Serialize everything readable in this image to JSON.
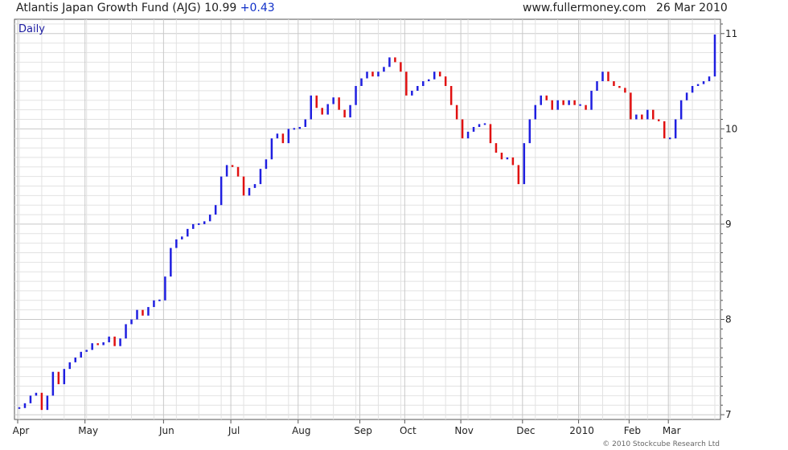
{
  "header": {
    "title": "Atlantis Japan Growth Fund (AJG) 10.99",
    "change": "+0.43",
    "site": "www.fullermoney.com",
    "date": "26 Mar 2010"
  },
  "period_label": "Daily",
  "copyright": "© 2010 Stockcube Research Ltd",
  "colors": {
    "up": "#1f1fe0",
    "down": "#e01010",
    "grid": "#e2e2e2",
    "major_grid": "#c8c8c8"
  },
  "chart_data": {
    "type": "line",
    "style": "close-to-close bars colored by direction (blue up, red down)",
    "x_ticks": [
      "Apr",
      "May",
      "Jun",
      "Jul",
      "Aug",
      "Sep",
      "Oct",
      "Nov",
      "Dec",
      "2010",
      "Feb",
      "Mar"
    ],
    "y_ticks": [
      7,
      8,
      9,
      10,
      11
    ],
    "ylim": [
      6.95,
      11.15
    ],
    "grid": true,
    "series": [
      {
        "points": [
          [
            "Apr",
            7.07
          ],
          [
            "Apr",
            7.12
          ],
          [
            "Apr",
            7.2
          ],
          [
            "Apr",
            7.23
          ],
          [
            "Apr",
            7.05
          ],
          [
            "Apr",
            7.2
          ],
          [
            "Apr",
            7.45
          ],
          [
            "Apr",
            7.32
          ],
          [
            "Apr",
            7.48
          ],
          [
            "Apr",
            7.55
          ],
          [
            "Apr",
            7.6
          ],
          [
            "Apr",
            7.66
          ],
          [
            "May",
            7.68
          ],
          [
            "May",
            7.75
          ],
          [
            "May",
            7.73
          ],
          [
            "May",
            7.76
          ],
          [
            "May",
            7.82
          ],
          [
            "May",
            7.72
          ],
          [
            "May",
            7.8
          ],
          [
            "May",
            7.95
          ],
          [
            "May",
            8.0
          ],
          [
            "May",
            8.1
          ],
          [
            "May",
            8.04
          ],
          [
            "May",
            8.13
          ],
          [
            "May",
            8.2
          ],
          [
            "May",
            8.2
          ],
          [
            "Jun",
            8.45
          ],
          [
            "Jun",
            8.75
          ],
          [
            "Jun",
            8.84
          ],
          [
            "Jun",
            8.87
          ],
          [
            "Jun",
            8.95
          ],
          [
            "Jun",
            9.0
          ],
          [
            "Jun",
            9.0
          ],
          [
            "Jun",
            9.03
          ],
          [
            "Jun",
            9.1
          ],
          [
            "Jun",
            9.2
          ],
          [
            "Jun",
            9.5
          ],
          [
            "Jun",
            9.62
          ],
          [
            "Jul",
            9.6
          ],
          [
            "Jul",
            9.5
          ],
          [
            "Jul",
            9.3
          ],
          [
            "Jul",
            9.38
          ],
          [
            "Jul",
            9.42
          ],
          [
            "Jul",
            9.58
          ],
          [
            "Jul",
            9.68
          ],
          [
            "Jul",
            9.9
          ],
          [
            "Jul",
            9.95
          ],
          [
            "Jul",
            9.85
          ],
          [
            "Jul",
            10.0
          ],
          [
            "Jul",
            10.0
          ],
          [
            "Aug",
            10.02
          ],
          [
            "Aug",
            10.1
          ],
          [
            "Aug",
            10.35
          ],
          [
            "Aug",
            10.22
          ],
          [
            "Aug",
            10.15
          ],
          [
            "Aug",
            10.26
          ],
          [
            "Aug",
            10.33
          ],
          [
            "Aug",
            10.2
          ],
          [
            "Aug",
            10.12
          ],
          [
            "Aug",
            10.25
          ],
          [
            "Aug",
            10.45
          ],
          [
            "Sep",
            10.53
          ],
          [
            "Sep",
            10.6
          ],
          [
            "Sep",
            10.55
          ],
          [
            "Sep",
            10.6
          ],
          [
            "Sep",
            10.65
          ],
          [
            "Sep",
            10.75
          ],
          [
            "Sep",
            10.7
          ],
          [
            "Sep",
            10.6
          ],
          [
            "Oct",
            10.35
          ],
          [
            "Oct",
            10.4
          ],
          [
            "Oct",
            10.45
          ],
          [
            "Oct",
            10.5
          ],
          [
            "Oct",
            10.52
          ],
          [
            "Oct",
            10.6
          ],
          [
            "Oct",
            10.55
          ],
          [
            "Oct",
            10.45
          ],
          [
            "Oct",
            10.25
          ],
          [
            "Oct",
            10.1
          ],
          [
            "Nov",
            9.9
          ],
          [
            "Nov",
            9.97
          ],
          [
            "Nov",
            10.02
          ],
          [
            "Nov",
            10.05
          ],
          [
            "Nov",
            10.05
          ],
          [
            "Nov",
            9.85
          ],
          [
            "Nov",
            9.75
          ],
          [
            "Nov",
            9.68
          ],
          [
            "Nov",
            9.7
          ],
          [
            "Nov",
            9.62
          ],
          [
            "Nov",
            9.42
          ],
          [
            "Dec",
            9.85
          ],
          [
            "Dec",
            10.1
          ],
          [
            "Dec",
            10.25
          ],
          [
            "Dec",
            10.35
          ],
          [
            "Dec",
            10.3
          ],
          [
            "Dec",
            10.2
          ],
          [
            "Dec",
            10.3
          ],
          [
            "Dec",
            10.25
          ],
          [
            "Dec",
            10.3
          ],
          [
            "Dec",
            10.25
          ],
          [
            "2010",
            10.25
          ],
          [
            "2010",
            10.2
          ],
          [
            "2010",
            10.4
          ],
          [
            "2010",
            10.5
          ],
          [
            "2010",
            10.6
          ],
          [
            "2010",
            10.5
          ],
          [
            "2010",
            10.45
          ],
          [
            "2010",
            10.43
          ],
          [
            "2010",
            10.38
          ],
          [
            "Feb",
            10.1
          ],
          [
            "Feb",
            10.15
          ],
          [
            "Feb",
            10.1
          ],
          [
            "Feb",
            10.2
          ],
          [
            "Feb",
            10.1
          ],
          [
            "Feb",
            10.08
          ],
          [
            "Feb",
            9.9
          ],
          [
            "Mar",
            9.9
          ],
          [
            "Mar",
            10.1
          ],
          [
            "Mar",
            10.3
          ],
          [
            "Mar",
            10.38
          ],
          [
            "Mar",
            10.45
          ],
          [
            "Mar",
            10.47
          ],
          [
            "Mar",
            10.5
          ],
          [
            "Mar",
            10.55
          ],
          [
            "Mar",
            10.99
          ]
        ]
      }
    ]
  }
}
